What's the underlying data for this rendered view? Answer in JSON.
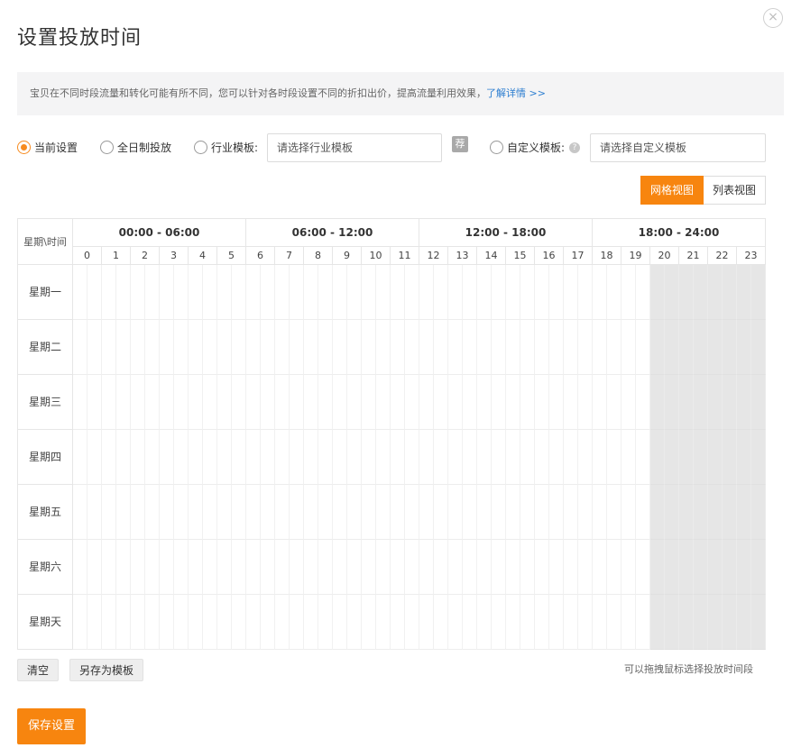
{
  "dialog": {
    "title": "设置投放时间",
    "close_symbol": "×"
  },
  "notice": {
    "text": "宝贝在不同时段流量和转化可能有所不同，您可以针对各时段设置不同的折扣出价，提高流量利用效果，",
    "link": "了解详情 >>"
  },
  "options": {
    "current": "当前设置",
    "fullday": "全日制投放",
    "industry": "行业模板:",
    "industry_placeholder": "请选择行业模板",
    "recommend_icon_text": "荐",
    "custom": "自定义模板:",
    "custom_placeholder": "请选择自定义模板",
    "help_symbol": "?",
    "selected": "current"
  },
  "view": {
    "grid_label": "网格视图",
    "list_label": "列表视图",
    "active": "grid"
  },
  "grid": {
    "corner_label": "星期\\时间",
    "ranges": [
      "00:00 - 06:00",
      "06:00 - 12:00",
      "12:00 - 18:00",
      "18:00 - 24:00"
    ],
    "hours": [
      "0",
      "1",
      "2",
      "3",
      "4",
      "5",
      "6",
      "7",
      "8",
      "9",
      "10",
      "11",
      "12",
      "13",
      "14",
      "15",
      "16",
      "17",
      "18",
      "19",
      "20",
      "21",
      "22",
      "23"
    ],
    "days": [
      "星期一",
      "星期二",
      "星期三",
      "星期四",
      "星期五",
      "星期六",
      "星期天"
    ],
    "selected_hours": [
      20,
      21,
      22,
      23
    ],
    "selected_color": "#e6e6e6"
  },
  "actions": {
    "clear": "清空",
    "save_template": "另存为模板",
    "hint": "可以拖拽鼠标选择投放时间段",
    "save": "保存设置"
  },
  "colors": {
    "accent": "#f7850f",
    "link": "#2b7dd0"
  }
}
